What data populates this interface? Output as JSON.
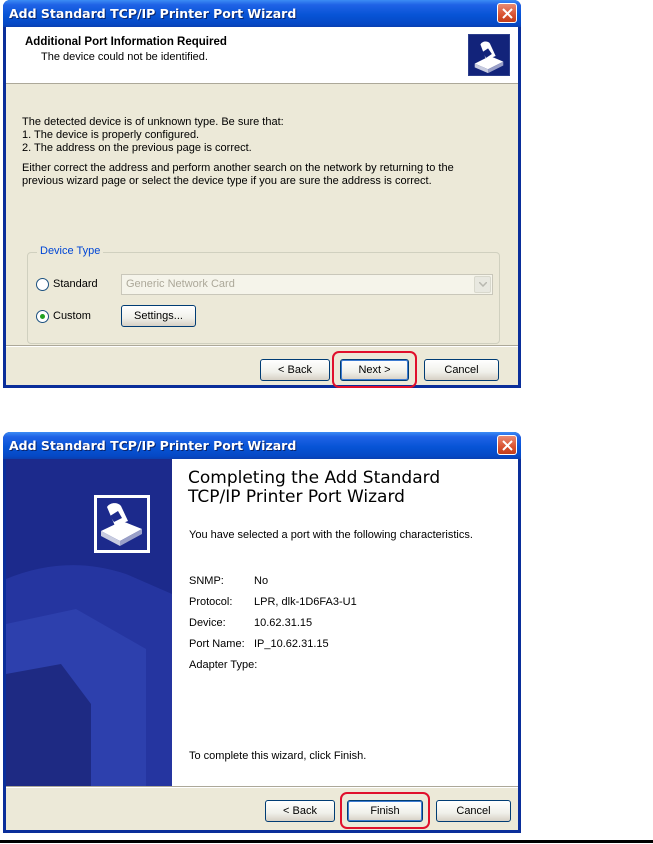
{
  "window1": {
    "title": "Add Standard TCP/IP Printer Port Wizard",
    "header_title": "Additional Port Information Required",
    "header_subtitle": "The device could not be identified.",
    "body_lines": [
      "The detected device is of unknown type.  Be sure that:",
      "1. The device is properly configured.",
      "2.  The address on the previous page is correct."
    ],
    "body_paragraph2_lines": [
      "Either correct the address and perform another search on the network by returning to the",
      "previous wizard page or select the device type if you are sure the address is correct."
    ],
    "device_type_label": "Device Type",
    "standard_label": "Standard",
    "standard_combo_value": "Generic Network Card",
    "custom_label": "Custom",
    "settings_button": "Settings...",
    "back_button": "< Back",
    "next_button": "Next >",
    "cancel_button": "Cancel"
  },
  "window2": {
    "title": "Add Standard TCP/IP Printer Port Wizard",
    "heading_line1": "Completing the Add Standard",
    "heading_line2": "TCP/IP Printer Port Wizard",
    "intro": "You have selected a port with the following characteristics.",
    "fields": [
      {
        "key": "SNMP:",
        "value": "No"
      },
      {
        "key": "Protocol:",
        "value": "LPR, dlk-1D6FA3-U1"
      },
      {
        "key": "Device:",
        "value": "10.62.31.15"
      },
      {
        "key": "Port Name:",
        "value": "IP_10.62.31.15"
      },
      {
        "key": "Adapter Type:",
        "value": ""
      }
    ],
    "finish_note": "To complete this wizard, click Finish.",
    "back_button": "< Back",
    "finish_button": "Finish",
    "cancel_button": "Cancel"
  },
  "colors": {
    "highlight": "#e0102c",
    "titlebar": "#0754d6",
    "dialog_bg": "#ece9d8",
    "group_label": "#0046d5"
  },
  "icons": [
    "close-icon",
    "printer-wizard-icon",
    "dropdown-arrow-icon"
  ]
}
